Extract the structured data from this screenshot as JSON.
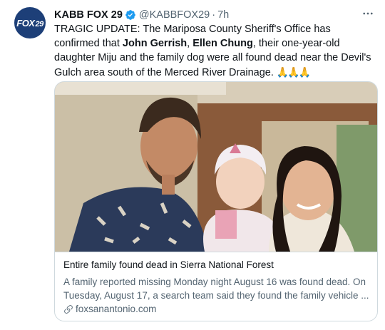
{
  "tweet": {
    "display_name": "KABB FOX 29",
    "handle": "@KABBFOX29",
    "separator": "·",
    "time": "7h",
    "avatar_logo_text": "FOX",
    "avatar_logo_num": "29",
    "text_parts": [
      "TRAGIC UPDATE: The Mariposa County Sheriff's Office has confirmed that ",
      "John Gerrish",
      ", ",
      "Ellen Chung",
      ", their one-year-old daughter Miju and the family dog were all found dead near the Devil's Gulch area south of the Merced River Drainage. ",
      "🙏🙏🙏"
    ]
  },
  "card": {
    "title": "Entire family found dead in Sierra National Forest",
    "description": "A family reported missing Monday night August 16 was found dead. On Tuesday, August 17, a search team said they found the family vehicle ...",
    "domain": "foxsanantonio.com"
  },
  "colors": {
    "text": "#0f1419",
    "secondary": "#536471",
    "verified": "#1d9bf0",
    "border": "#cfd9de",
    "avatar_bg": "#1d3f78"
  },
  "icons": [
    "verified-badge-icon",
    "more-icon",
    "link-icon"
  ]
}
